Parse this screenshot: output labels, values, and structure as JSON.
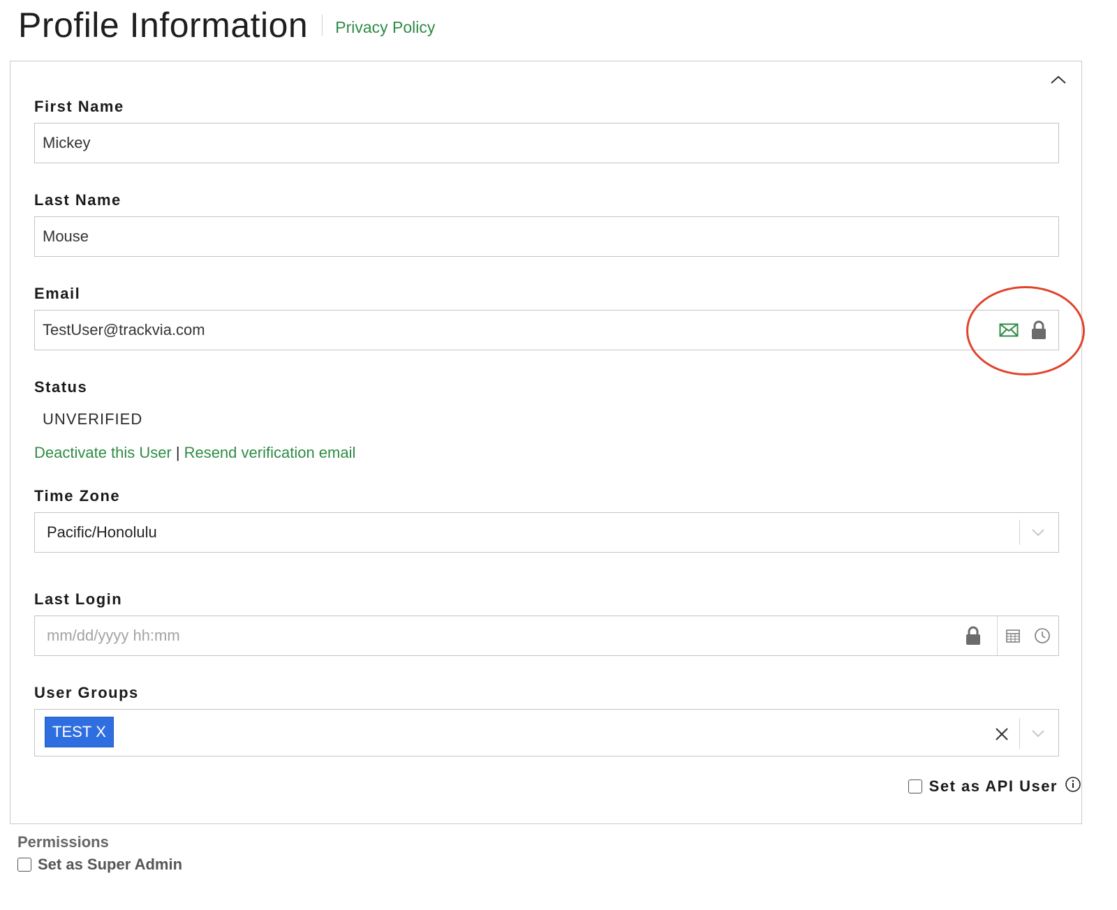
{
  "header": {
    "title": "Profile Information",
    "privacy_link": "Privacy Policy"
  },
  "form": {
    "first_name": {
      "label": "First Name",
      "value": "Mickey"
    },
    "last_name": {
      "label": "Last Name",
      "value": "Mouse"
    },
    "email": {
      "label": "Email",
      "value": "TestUser@trackvia.com"
    },
    "status": {
      "label": "Status",
      "value": "UNVERIFIED",
      "deactivate_link": "Deactivate this User",
      "separator": "|",
      "resend_link": "Resend verification email"
    },
    "time_zone": {
      "label": "Time Zone",
      "value": "Pacific/Honolulu"
    },
    "last_login": {
      "label": "Last Login",
      "placeholder": "mm/dd/yyyy hh:mm",
      "value": ""
    },
    "user_groups": {
      "label": "User Groups",
      "tags": [
        {
          "label": "TEST",
          "remove": "X"
        }
      ]
    },
    "api_user": {
      "label": "Set as API User",
      "checked": false
    }
  },
  "permissions": {
    "title": "Permissions",
    "super_admin": {
      "label": "Set as Super Admin",
      "checked": false
    }
  },
  "colors": {
    "link_green": "#2e8b45",
    "tag_blue": "#2f6ee0",
    "annotation_red": "#e0432b"
  },
  "icons": [
    "chevron-up-icon",
    "envelope-icon",
    "lock-icon",
    "chevron-down-icon",
    "calendar-icon",
    "clock-icon",
    "clear-x-icon",
    "info-icon"
  ]
}
